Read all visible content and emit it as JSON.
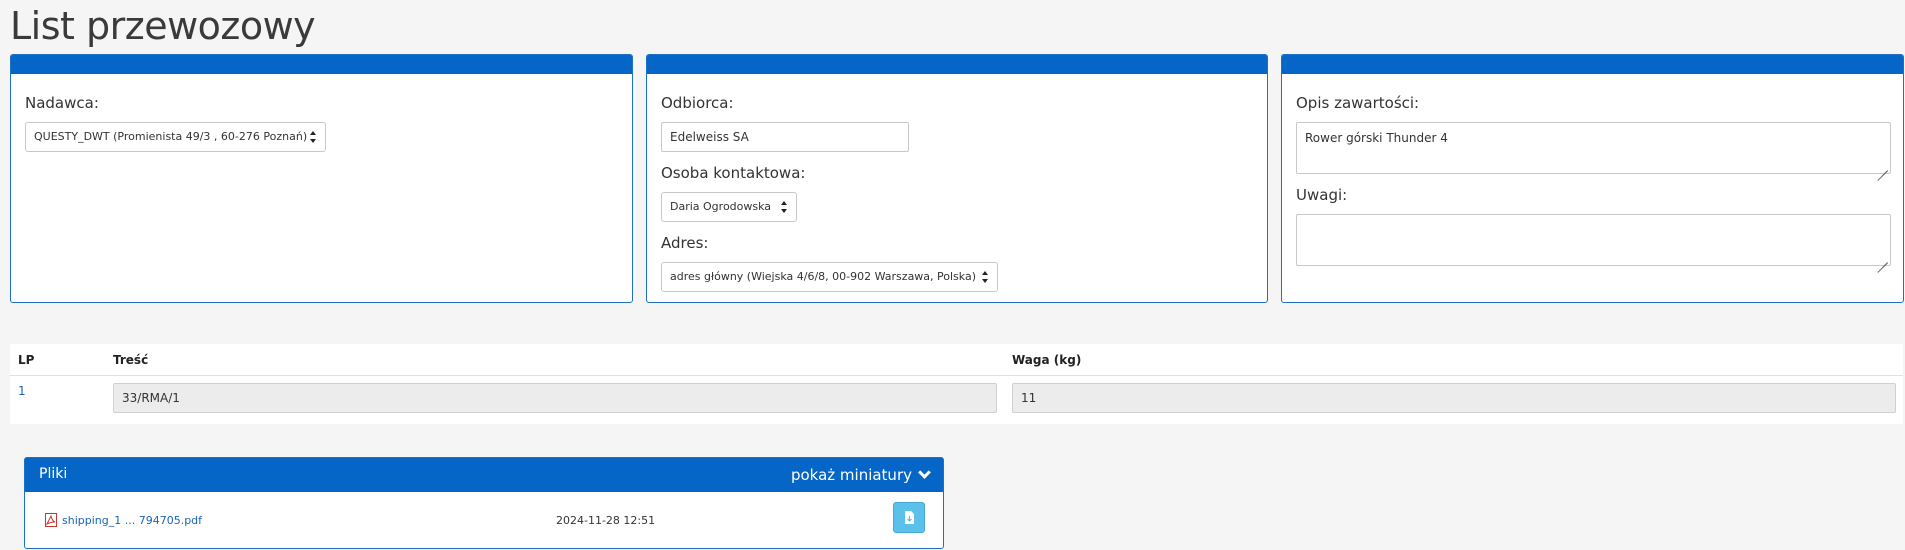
{
  "page": {
    "title": "List przewozowy"
  },
  "sender": {
    "label": "Nadawca:",
    "value": "QUESTY_DWT (Promienista 49/3 , 60-276 Poznań)"
  },
  "recipient": {
    "label": "Odbiorca:",
    "value": "Edelweiss SA",
    "contact_label": "Osoba kontaktowa:",
    "contact_value": "Daria Ogrodowska",
    "address_label": "Adres:",
    "address_value": "adres główny (Wiejska 4/6/8, 00-902 Warszawa, Polska)"
  },
  "contents": {
    "description_label": "Opis zawartości:",
    "description_value": "Rower górski Thunder 4",
    "notes_label": "Uwagi:",
    "notes_value": ""
  },
  "items_table": {
    "headers": {
      "lp": "LP",
      "content": "Treść",
      "weight": "Waga (kg)"
    },
    "rows": [
      {
        "lp": "1",
        "content": "33/RMA/1",
        "weight": "11"
      }
    ]
  },
  "files": {
    "title": "Pliki",
    "toggle_label": "pokaż miniatury",
    "items": [
      {
        "name": "shipping_1 ... 794705.pdf",
        "date": "2024-11-28 12:51",
        "icon": "pdf-icon"
      }
    ]
  },
  "colors": {
    "accent": "#0566c8",
    "button": "#5bc0ea",
    "link": "#1a64b8"
  }
}
